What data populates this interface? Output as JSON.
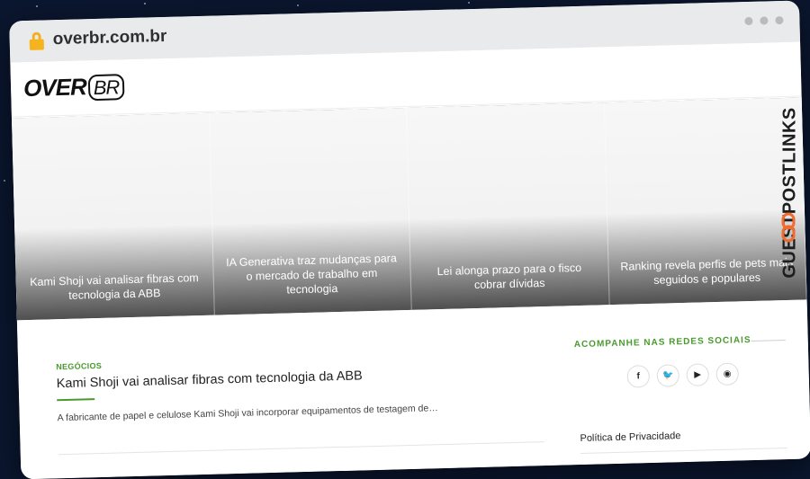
{
  "browser": {
    "url": "overbr.com.br"
  },
  "header": {
    "logo_main": "OVER",
    "logo_suffix": "BR"
  },
  "hero": {
    "slides": [
      {
        "title": "Kami Shoji vai analisar fibras com tecnologia da ABB"
      },
      {
        "title": "IA Generativa traz mudanças para o mercado de trabalho em tecnologia"
      },
      {
        "title": "Lei alonga prazo para o fisco cobrar dívidas"
      },
      {
        "title": "Ranking revela perfis de pets mais seguidos e populares"
      }
    ]
  },
  "article": {
    "category": "NEGÓCIOS",
    "title": "Kami Shoji vai analisar fibras com tecnologia da ABB",
    "excerpt": "A fabricante de papel e celulose Kami Shoji vai incorporar equipamentos de testagem de…"
  },
  "sidebar": {
    "social_heading": "ACOMPANHE NAS REDES SOCIAIS",
    "social_icons": [
      {
        "name": "facebook-icon",
        "glyph": "f"
      },
      {
        "name": "twitter-icon",
        "glyph": "🐦"
      },
      {
        "name": "youtube-icon",
        "glyph": "▶"
      },
      {
        "name": "rss-icon",
        "glyph": "◉"
      }
    ],
    "privacy_link": "Política de Privacidade"
  },
  "watermark": {
    "text": "GUESTPOSTLINKS"
  },
  "colors": {
    "accent": "#4b9a2e",
    "lock": "#f5b41f",
    "watermark_logo": "#f26b2a"
  }
}
